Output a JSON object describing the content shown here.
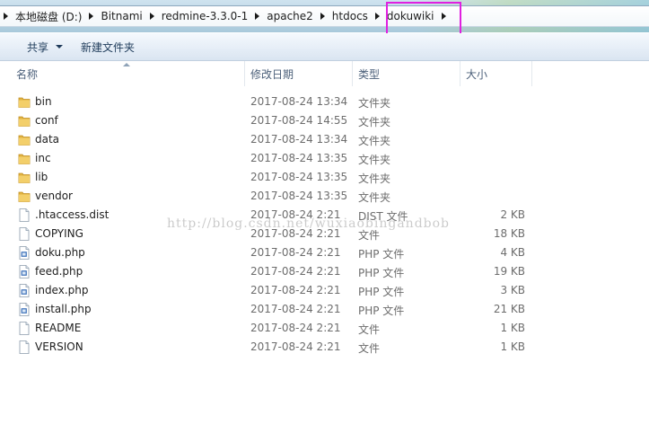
{
  "breadcrumb": [
    "本地磁盘 (D:)",
    "Bitnami",
    "redmine-3.3.0-1",
    "apache2",
    "htdocs",
    "dokuwiki"
  ],
  "toolbar": {
    "share_label": "共享",
    "new_folder_label": "新建文件夹"
  },
  "columns": {
    "name": "名称",
    "date": "修改日期",
    "type": "类型",
    "size": "大小"
  },
  "files": [
    {
      "name": "bin",
      "date": "2017-08-24 13:34",
      "type": "文件夹",
      "size": "",
      "kind": "folder"
    },
    {
      "name": "conf",
      "date": "2017-08-24 14:55",
      "type": "文件夹",
      "size": "",
      "kind": "folder"
    },
    {
      "name": "data",
      "date": "2017-08-24 13:34",
      "type": "文件夹",
      "size": "",
      "kind": "folder"
    },
    {
      "name": "inc",
      "date": "2017-08-24 13:35",
      "type": "文件夹",
      "size": "",
      "kind": "folder"
    },
    {
      "name": "lib",
      "date": "2017-08-24 13:35",
      "type": "文件夹",
      "size": "",
      "kind": "folder"
    },
    {
      "name": "vendor",
      "date": "2017-08-24 13:35",
      "type": "文件夹",
      "size": "",
      "kind": "folder"
    },
    {
      "name": ".htaccess.dist",
      "date": "2017-08-24 2:21",
      "type": "DIST 文件",
      "size": "2 KB",
      "kind": "file"
    },
    {
      "name": "COPYING",
      "date": "2017-08-24 2:21",
      "type": "文件",
      "size": "18 KB",
      "kind": "file"
    },
    {
      "name": "doku.php",
      "date": "2017-08-24 2:21",
      "type": "PHP 文件",
      "size": "4 KB",
      "kind": "php"
    },
    {
      "name": "feed.php",
      "date": "2017-08-24 2:21",
      "type": "PHP 文件",
      "size": "19 KB",
      "kind": "php"
    },
    {
      "name": "index.php",
      "date": "2017-08-24 2:21",
      "type": "PHP 文件",
      "size": "3 KB",
      "kind": "php"
    },
    {
      "name": "install.php",
      "date": "2017-08-24 2:21",
      "type": "PHP 文件",
      "size": "21 KB",
      "kind": "php"
    },
    {
      "name": "README",
      "date": "2017-08-24 2:21",
      "type": "文件",
      "size": "1 KB",
      "kind": "file"
    },
    {
      "name": "VERSION",
      "date": "2017-08-24 2:21",
      "type": "文件",
      "size": "1 KB",
      "kind": "file"
    }
  ],
  "watermark": "http://blog.csdn.net/wuxiaobingandbob",
  "colors": {
    "highlight": "#e020e0",
    "folder": "#e8b84a",
    "header_text": "#4c607a"
  }
}
